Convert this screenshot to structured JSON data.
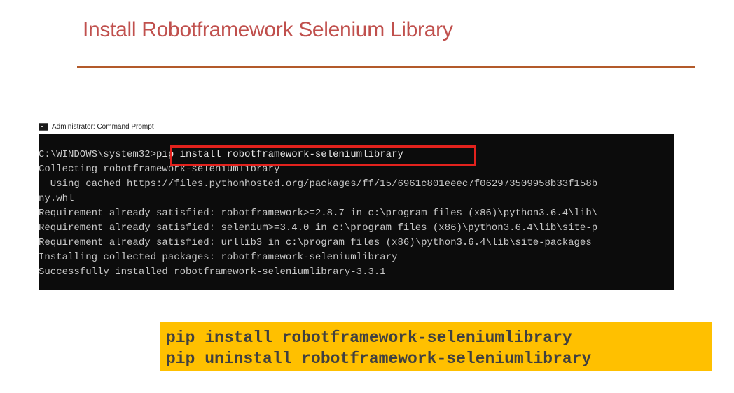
{
  "slide": {
    "title": "Install Robotframework Selenium Library"
  },
  "terminal": {
    "window_title": "Administrator: Command Prompt",
    "prompt": "C:\\WINDOWS\\system32>",
    "command": "pip install robotframework-seleniumlibrary",
    "output_lines": [
      "Collecting robotframework-seleniumlibrary",
      "  Using cached https://files.pythonhosted.org/packages/ff/15/6961c801eeec7f062973509958b33f158b",
      "ny.whl",
      "Requirement already satisfied: robotframework>=2.8.7 in c:\\program files (x86)\\python3.6.4\\lib\\",
      "Requirement already satisfied: selenium>=3.4.0 in c:\\program files (x86)\\python3.6.4\\lib\\site-p",
      "Requirement already satisfied: urllib3 in c:\\program files (x86)\\python3.6.4\\lib\\site-packages",
      "Installing collected packages: robotframework-seleniumlibrary",
      "Successfully installed robotframework-seleniumlibrary-3.3.1"
    ]
  },
  "commands_box": {
    "install": "pip install robotframework-seleniumlibrary",
    "uninstall": "pip uninstall robotframework-seleniumlibrary"
  },
  "colors": {
    "title": "#c0504d",
    "rule": "#b35a2a",
    "highlight_border": "#e3221d",
    "command_box_bg": "#ffc000",
    "console_bg": "#0c0c0c"
  },
  "icons": {
    "console": "cmd-window-icon"
  }
}
